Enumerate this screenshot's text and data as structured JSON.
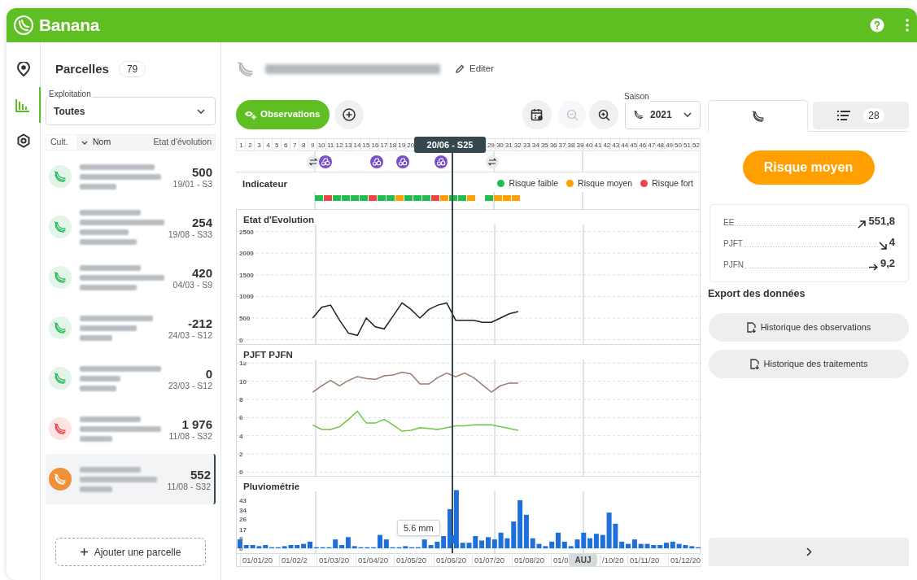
{
  "app": {
    "name": "Banana"
  },
  "nav": [
    {
      "kind": "map",
      "selected": false
    },
    {
      "kind": "stats",
      "selected": true
    },
    {
      "kind": "settings",
      "selected": false
    }
  ],
  "parcels": {
    "title": "Parcelles",
    "count": "79",
    "filter": {
      "label": "Exploitation",
      "value": "Toutes"
    },
    "columns": [
      "Cult.",
      "Nom",
      "Etat d'évolution"
    ],
    "rows": [
      {
        "color": "#22b455",
        "value": "500",
        "date": "19/01 - S3",
        "selected": false
      },
      {
        "color": "#22b455",
        "value": "254",
        "date": "19/08 - S33",
        "selected": false
      },
      {
        "color": "#22b455",
        "value": "420",
        "date": "04/03 - S9",
        "selected": false
      },
      {
        "color": "#22b455",
        "value": "-212",
        "date": "24/03 - S12",
        "selected": false
      },
      {
        "color": "#22b455",
        "value": "0",
        "date": "23/03 - S12",
        "selected": false
      },
      {
        "color": "#e8383d",
        "value": "1 976",
        "date": "11/08 - S32",
        "selected": false
      },
      {
        "color": "#f0913a",
        "value": "552",
        "date": "11/08 - S32",
        "selected": true
      }
    ],
    "add_label": "Ajouter une parcelle"
  },
  "detail": {
    "edit_label": "Editer",
    "observations_label": "Observations",
    "zoom_out_disabled": true,
    "season": {
      "label": "Saison",
      "value": "2021"
    }
  },
  "timeline": {
    "weeks_start": [
      "1",
      "2",
      "3",
      "4",
      "5",
      "6",
      "7",
      "8",
      "9",
      "10",
      "11",
      "12",
      "13",
      "14",
      "15",
      "16",
      "17",
      "18",
      "19",
      "20"
    ],
    "weeks_end": [
      "29",
      "30",
      "31",
      "32",
      "33",
      "34",
      "35",
      "36",
      "37",
      "38",
      "39",
      "40",
      "41",
      "42",
      "43",
      "44",
      "45",
      "46",
      "47",
      "48",
      "49",
      "50",
      "51",
      "52"
    ],
    "cursor_label": "20/06 - S25",
    "markers": [
      {
        "kind": "swap"
      },
      {
        "kind": "treatment"
      },
      {
        "kind": "treatment"
      },
      {
        "kind": "treatment"
      },
      {
        "kind": "treatment"
      },
      {
        "kind": "swap"
      }
    ],
    "indicator": {
      "title": "Indicateur",
      "legend": [
        {
          "label": "Risque faible",
          "color": "#1fbf4f"
        },
        {
          "label": "Risque moyen",
          "color": "#ffa000"
        },
        {
          "label": "Risque fort",
          "color": "#ef4444"
        }
      ],
      "risk_groups": [
        {
          "segments": [
            {
              "color": "#1fbf4f"
            },
            {
              "color": "#ef4444"
            },
            {
              "color": "#1fbf4f"
            },
            {
              "color": "#1fbf4f"
            },
            {
              "color": "#1fbf4f"
            },
            {
              "color": "#1fbf4f"
            },
            {
              "color": "#ef4444"
            },
            {
              "color": "#1fbf4f"
            },
            {
              "color": "#1fbf4f"
            },
            {
              "color": "#ffa000"
            },
            {
              "color": "#1fbf4f"
            },
            {
              "color": "#1fbf4f"
            },
            {
              "color": "#1fbf4f"
            },
            {
              "color": "#ef4444"
            },
            {
              "color": "#ffa000"
            },
            {
              "color": "#1fbf4f"
            },
            {
              "color": "#1fbf4f"
            },
            {
              "color": "#ffa000"
            }
          ]
        },
        {
          "segments": [
            {
              "color": "#1fbf4f"
            },
            {
              "color": "#ffa000"
            },
            {
              "color": "#ffa000"
            },
            {
              "color": "#ffa000"
            }
          ]
        }
      ]
    },
    "evolution": {
      "chart_data": {
        "type": "line",
        "title": "Etat d'Evolution",
        "grid": true,
        "categories": [
          null,
          null,
          null,
          null,
          null,
          null,
          null,
          null,
          null,
          null,
          null,
          null,
          null,
          null,
          null,
          null,
          null,
          null,
          null,
          null,
          null,
          null,
          null,
          null,
          null,
          null,
          null,
          null,
          null,
          null,
          null,
          null,
          null,
          null,
          null,
          null,
          null,
          null,
          null,
          null,
          null,
          null,
          null,
          null,
          null,
          null,
          null,
          null,
          null,
          null,
          null,
          null
        ],
        "ylim": [
          -120,
          3000
        ],
        "yticks": [
          0,
          500,
          1000,
          1500,
          2000,
          2500
        ],
        "series": [
          {
            "color": "#222222",
            "values": [
              null,
              null,
              null,
              null,
              null,
              null,
              null,
              null,
              500,
              750,
              800,
              450,
              150,
              100,
              500,
              300,
              250,
              550,
              850,
              700,
              500,
              700,
              800,
              850,
              450,
              450,
              450,
              400,
              400,
              500,
              600,
              650,
              null,
              null,
              null,
              null,
              null,
              null,
              null,
              null,
              null,
              null,
              null,
              null,
              null,
              null,
              null,
              null,
              null,
              null,
              null,
              null
            ]
          }
        ]
      }
    },
    "pjft_pjfn": {
      "chart_data": {
        "type": "line",
        "title": "PJFT PJFN",
        "grid": true,
        "categories": [
          null,
          null,
          null,
          null,
          null,
          null,
          null,
          null,
          null,
          null,
          null,
          null,
          null,
          null,
          null,
          null,
          null,
          null,
          null,
          null,
          null,
          null,
          null,
          null,
          null,
          null,
          null,
          null,
          null,
          null,
          null,
          null,
          null,
          null,
          null,
          null,
          null,
          null,
          null,
          null,
          null,
          null,
          null,
          null,
          null,
          null,
          null,
          null,
          null,
          null,
          null,
          null
        ],
        "ylim": [
          -0.5,
          14
        ],
        "yticks": [
          0,
          2,
          4,
          6,
          8,
          10,
          12
        ],
        "series": [
          {
            "color": "#9b7b6e",
            "values": [
              null,
              null,
              null,
              null,
              null,
              null,
              null,
              null,
              8.8,
              9.5,
              10.1,
              9.5,
              10.1,
              10.5,
              10.3,
              10.2,
              10.6,
              10.7,
              11.0,
              10.8,
              9.7,
              9.7,
              10.4,
              10.9,
              10.5,
              10.9,
              10.4,
              9.6,
              8.8,
              9.5,
              9.8,
              9.8,
              null,
              null,
              null,
              null,
              null,
              null,
              null,
              null,
              null,
              null,
              null,
              null,
              null,
              null,
              null,
              null,
              null,
              null,
              null,
              null
            ]
          },
          {
            "color": "#6cc644",
            "values": [
              null,
              null,
              null,
              null,
              null,
              null,
              null,
              null,
              5.2,
              4.7,
              4.7,
              5.0,
              5.8,
              6.7,
              5.4,
              5.4,
              5.8,
              5.2,
              4.5,
              4.6,
              4.9,
              4.8,
              4.7,
              4.9,
              5.1,
              5.1,
              5.2,
              5.2,
              5.2,
              5.0,
              4.8,
              4.6,
              null,
              null,
              null,
              null,
              null,
              null,
              null,
              null,
              null,
              null,
              null,
              null,
              null,
              null,
              null,
              null,
              null,
              null,
              null,
              null
            ]
          }
        ]
      }
    },
    "rain": {
      "chart_data": {
        "type": "bar",
        "title": "Pluviométrie",
        "grid": true,
        "categories": [
          null,
          null,
          null,
          null,
          null,
          null,
          null,
          null,
          null,
          null,
          null,
          null,
          null,
          null,
          null,
          null,
          null,
          null,
          null,
          null,
          null,
          null,
          null,
          null,
          null,
          null,
          null,
          null,
          null,
          null,
          null,
          null,
          null,
          null,
          null,
          null,
          null,
          null,
          null,
          null,
          null,
          null,
          null,
          null,
          null,
          null,
          null,
          null,
          null,
          null,
          null,
          null,
          null,
          null,
          null,
          null,
          null,
          null,
          null,
          null,
          null,
          null,
          null,
          null,
          null,
          null,
          null,
          null,
          null,
          null,
          null,
          null,
          null
        ],
        "ylim": [
          -5,
          64
        ],
        "yticks": [
          0,
          9,
          17,
          26,
          34,
          43
        ],
        "series": [
          {
            "color": "#1e6fd9",
            "values": [
              8,
              3,
              3,
              2,
              3,
              1,
              1,
              2,
              3,
              3,
              4,
              6,
              1,
              1,
              1,
              8,
              3,
              10,
              2,
              1,
              1,
              1,
              12,
              8,
              1,
              1,
              2,
              1,
              1,
              8,
              3,
              6,
              11,
              35,
              52,
              5,
              5,
              11,
              7,
              10,
              8,
              14,
              9,
              24,
              43,
              30,
              9,
              4,
              2,
              6,
              14,
              6,
              2,
              8,
              14,
              9,
              13,
              12,
              32,
              22,
              6,
              4,
              8,
              4,
              4,
              3,
              3,
              5,
              6,
              4,
              3,
              2,
              1
            ]
          }
        ]
      },
      "tooltip": "5.6 mm"
    },
    "dates": [
      "01/01/20",
      "01/02/2",
      "01/03/20",
      "01/04/20",
      "01/05/20",
      "01/06/20",
      "01/07/20",
      "01/08/20",
      "01/0",
      "/10/20",
      "01/11/20",
      "01/12/20"
    ],
    "today_label": "AUJ"
  },
  "side": {
    "tabs": [
      {
        "kind": "crop",
        "selected": true
      },
      {
        "kind": "list",
        "selected": false,
        "count": "28"
      }
    ],
    "risk": "Risque moyen",
    "stats": [
      {
        "label": "EE",
        "kind": "up",
        "value": "551,8"
      },
      {
        "label": "PJFT",
        "kind": "down",
        "value": "4"
      },
      {
        "label": "PJFN",
        "kind": "flat",
        "value": "9,2"
      }
    ],
    "export_title": "Export des données",
    "exports": [
      "Historique des observations",
      "Historique des traitements"
    ]
  }
}
